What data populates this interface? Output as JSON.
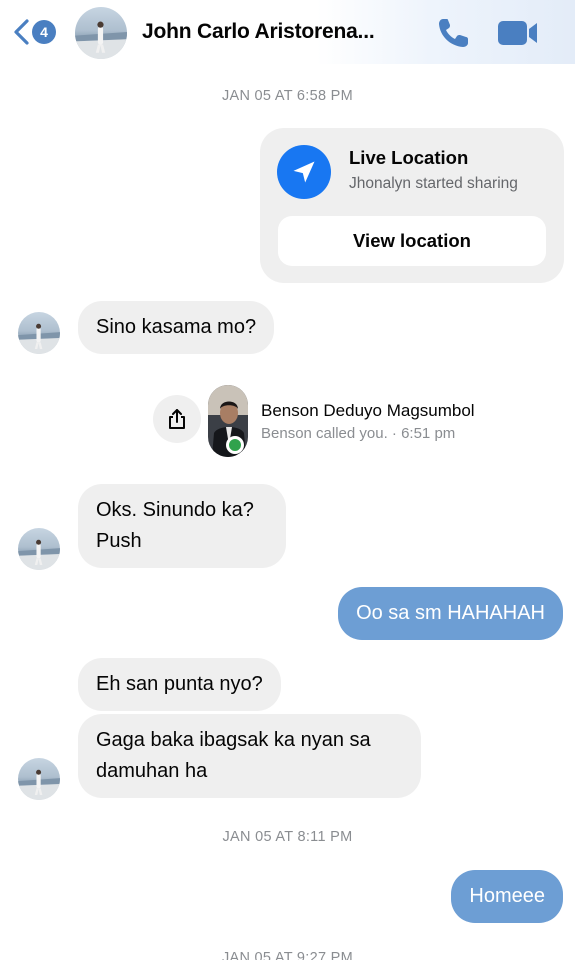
{
  "header": {
    "unread_count": "4",
    "contact_name": "John Carlo Aristorena..."
  },
  "colors": {
    "accent": "#4a7fc1",
    "outgoing_bubble": "#6d9ed4",
    "incoming_bubble": "#efefef",
    "location_icon": "#1877f2",
    "online": "#31a24c"
  },
  "icons": {
    "back": "chevron-left-icon",
    "call": "phone-icon",
    "video": "video-camera-icon",
    "location": "navigation-arrow-icon",
    "share": "share-icon"
  },
  "timestamps": {
    "t1": "JAN 05 AT 6:58 PM",
    "t2": "JAN 05 AT 8:11 PM",
    "t3": "JAN 05 AT 9:27 PM"
  },
  "live_location": {
    "title": "Live Location",
    "subtitle": "Jhonalyn started sharing",
    "button_label": "View location"
  },
  "call_event": {
    "caller_name": "Benson Deduyo Magsumbol",
    "detail": "Benson called you. · 6:51 pm"
  },
  "messages": [
    {
      "direction": "in",
      "text": "Sino kasama mo?"
    },
    {
      "direction": "in",
      "text": "Oks. Sinundo ka? Push"
    },
    {
      "direction": "out",
      "text": "Oo sa sm HAHAHAH"
    },
    {
      "direction": "in",
      "text": "Eh san punta nyo?"
    },
    {
      "direction": "in",
      "text": "Gaga baka ibagsak ka nyan sa damuhan ha"
    },
    {
      "direction": "out",
      "text": "Homeee"
    }
  ]
}
